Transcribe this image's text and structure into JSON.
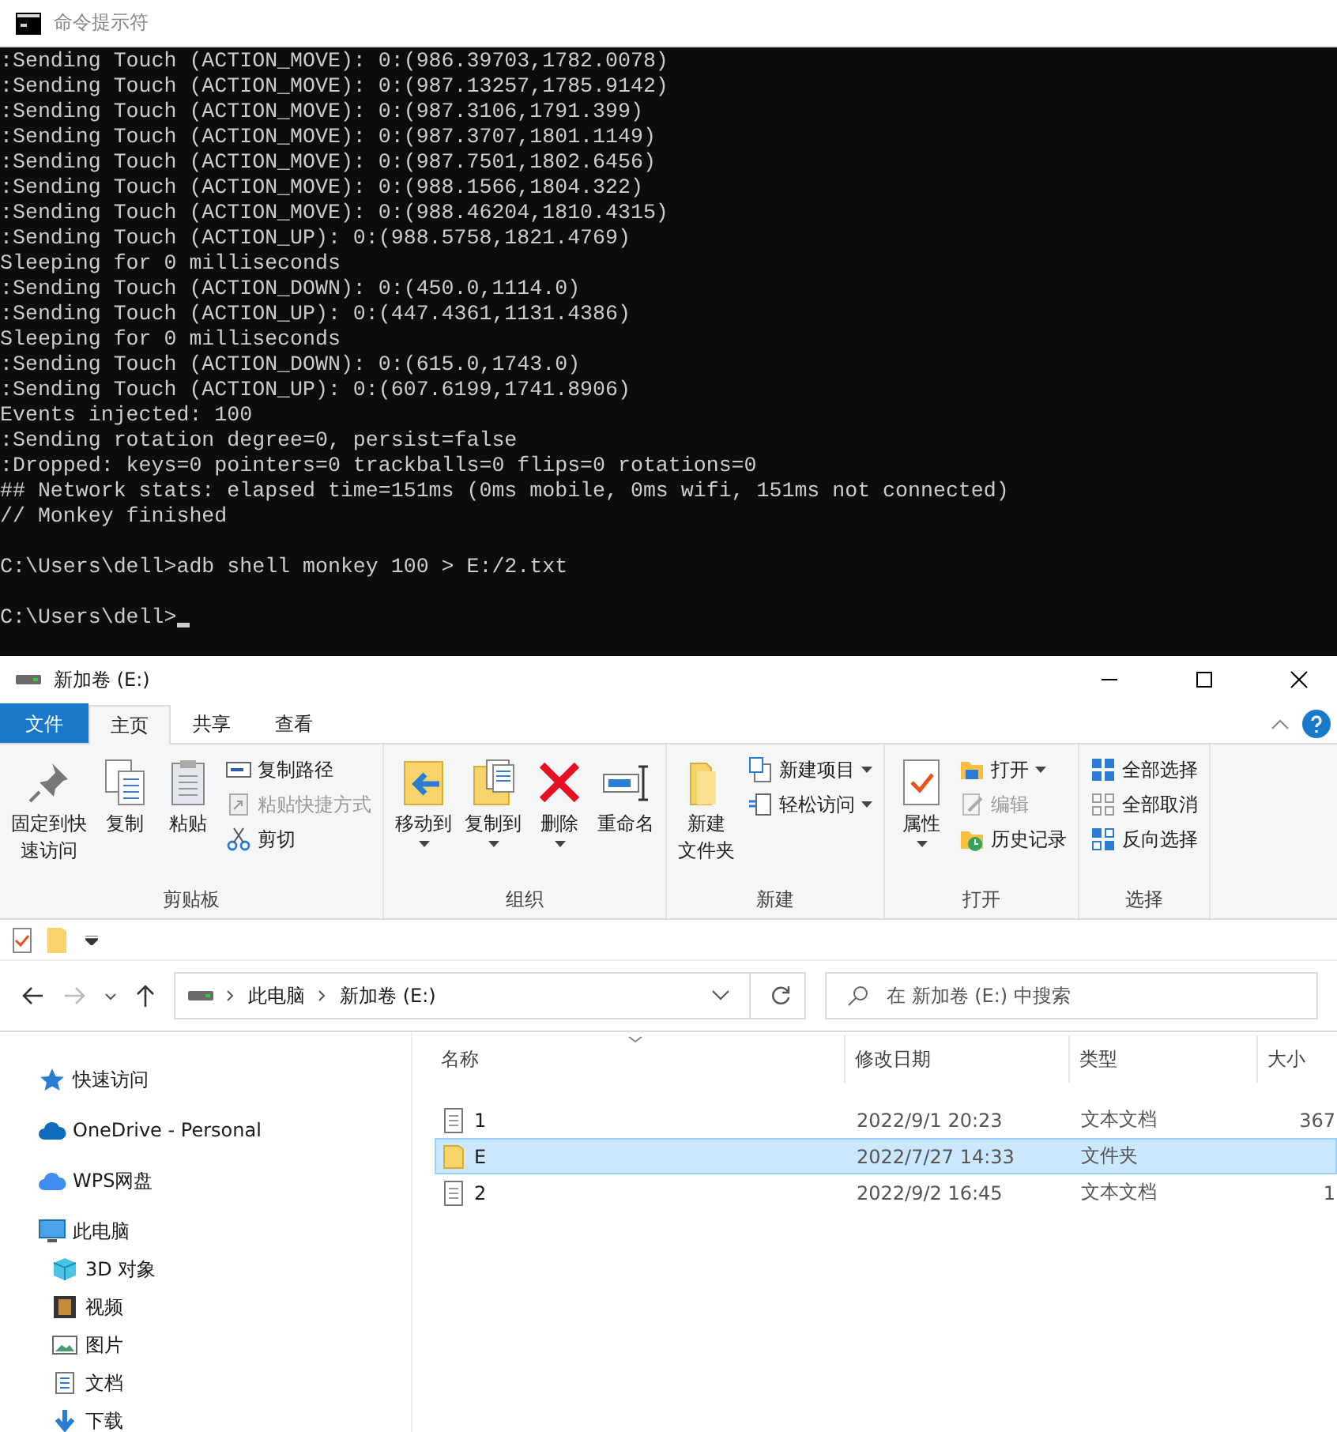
{
  "cmd": {
    "title": "命令提示符",
    "cursor": true,
    "blocks": [
      [
        ":Sending Touch (ACTION_MOVE): 0:(986.39703,1782.0078)",
        ":Sending Touch (ACTION_MOVE): 0:(987.13257,1785.9142)",
        ":Sending Touch (ACTION_MOVE): 0:(987.3106,1791.399)",
        ":Sending Touch (ACTION_MOVE): 0:(987.3707,1801.1149)",
        ":Sending Touch (ACTION_MOVE): 0:(987.7501,1802.6456)",
        ":Sending Touch (ACTION_MOVE): 0:(988.1566,1804.322)",
        ":Sending Touch (ACTION_MOVE): 0:(988.46204,1810.4315)",
        ":Sending Touch (ACTION_UP): 0:(988.5758,1821.4769)",
        "Sleeping for 0 milliseconds",
        ":Sending Touch (ACTION_DOWN): 0:(450.0,1114.0)",
        ":Sending Touch (ACTION_UP): 0:(447.4361,1131.4386)",
        "Sleeping for 0 milliseconds",
        ":Sending Touch (ACTION_DOWN): 0:(615.0,1743.0)",
        ":Sending Touch (ACTION_UP): 0:(607.6199,1741.8906)",
        "Events injected: 100",
        ":Sending rotation degree=0, persist=false",
        ":Dropped: keys=0 pointers=0 trackballs=0 flips=0 rotations=0",
        "## Network stats: elapsed time=151ms (0ms mobile, 0ms wifi, 151ms not connected)",
        "// Monkey finished"
      ],
      [
        "C:\\Users\\dell>adb shell monkey 100 > E:/2.txt"
      ],
      [
        "C:\\Users\\dell>"
      ]
    ]
  },
  "explorer": {
    "title": "新加卷 (E:)",
    "tabs": [
      {
        "label": "文件",
        "kind": "file",
        "selected": false
      },
      {
        "label": "主页",
        "kind": "tab",
        "selected": true
      },
      {
        "label": "共享",
        "kind": "tab",
        "selected": false
      },
      {
        "label": "查看",
        "kind": "tab",
        "selected": false
      }
    ],
    "groups": [
      {
        "label": "剪贴板",
        "large": [
          {
            "lines": [
              "固定到快",
              "速访问"
            ],
            "dropdown": false,
            "disabled": false
          },
          {
            "lines": [
              "复制"
            ],
            "dropdown": false,
            "disabled": false
          },
          {
            "lines": [
              "粘贴"
            ],
            "dropdown": false,
            "disabled": false
          }
        ],
        "small": [
          {
            "label": "复制路径",
            "dropdown": false,
            "disabled": false
          },
          {
            "label": "粘贴快捷方式",
            "dropdown": false,
            "disabled": true
          },
          {
            "label": "剪切",
            "dropdown": false,
            "disabled": false
          }
        ]
      },
      {
        "label": "组织",
        "large": [
          {
            "lines": [
              "移动到"
            ],
            "dropdown": true,
            "disabled": false
          },
          {
            "lines": [
              "复制到"
            ],
            "dropdown": true,
            "disabled": false
          },
          {
            "lines": [
              "删除"
            ],
            "dropdown": true,
            "disabled": false
          },
          {
            "lines": [
              "重命名"
            ],
            "dropdown": false,
            "disabled": false
          }
        ]
      },
      {
        "label": "新建",
        "large": [
          {
            "lines": [
              "新建",
              "文件夹"
            ],
            "dropdown": false,
            "disabled": false
          }
        ],
        "small": [
          {
            "label": "新建项目",
            "dropdown": true,
            "disabled": false
          },
          {
            "label": "轻松访问",
            "dropdown": true,
            "disabled": false
          }
        ]
      },
      {
        "label": "打开",
        "large": [
          {
            "lines": [
              "属性"
            ],
            "dropdown": true,
            "disabled": false
          }
        ],
        "small": [
          {
            "label": "打开",
            "dropdown": true,
            "disabled": false
          },
          {
            "label": "编辑",
            "dropdown": false,
            "disabled": true
          },
          {
            "label": "历史记录",
            "dropdown": false,
            "disabled": false
          }
        ]
      },
      {
        "label": "选择",
        "small": [
          {
            "label": "全部选择",
            "dropdown": false,
            "disabled": false
          },
          {
            "label": "全部取消",
            "dropdown": false,
            "disabled": false
          },
          {
            "label": "反向选择",
            "dropdown": false,
            "disabled": false
          }
        ]
      }
    ],
    "path": [
      "此电脑",
      "新加卷 (E:)"
    ],
    "search": {
      "placeholder": "在 新加卷 (E:) 中搜索"
    },
    "sidebar": [
      {
        "label": "快速访问"
      },
      {
        "label": "OneDrive - Personal"
      },
      {
        "label": "WPS网盘"
      },
      {
        "label": "此电脑",
        "children": [
          {
            "label": "3D 对象"
          },
          {
            "label": "视频"
          },
          {
            "label": "图片"
          },
          {
            "label": "文档"
          },
          {
            "label": "下载"
          }
        ]
      }
    ],
    "columns": [
      "名称",
      "修改日期",
      "类型",
      "大小"
    ],
    "rows": [
      {
        "kind": "file",
        "name": "1",
        "date": "2022/9/1 20:23",
        "type": "文本文档",
        "size": "367",
        "selected": false
      },
      {
        "kind": "folder",
        "name": "E",
        "date": "2022/7/27 14:33",
        "type": "文件夹",
        "selected": true
      },
      {
        "kind": "file",
        "name": "2",
        "date": "2022/9/2 16:45",
        "type": "文本文档",
        "size": "1",
        "selected": false
      }
    ]
  }
}
